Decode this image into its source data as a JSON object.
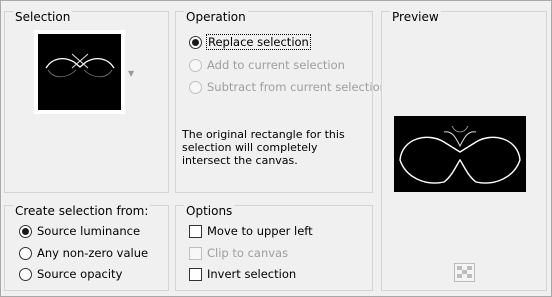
{
  "selection": {
    "title": "Selection"
  },
  "operation": {
    "title": "Operation",
    "options": [
      {
        "label": "Replace selection",
        "selected": true,
        "enabled": true
      },
      {
        "label": "Add to current selection",
        "selected": false,
        "enabled": false
      },
      {
        "label": "Subtract from current selection",
        "selected": false,
        "enabled": false
      }
    ],
    "description": "The original rectangle for this selection will completely intersect the canvas."
  },
  "preview": {
    "title": "Preview"
  },
  "create_from": {
    "title": "Create selection from:",
    "options": [
      {
        "label": "Source luminance",
        "selected": true
      },
      {
        "label": "Any non-zero value",
        "selected": false
      },
      {
        "label": "Source opacity",
        "selected": false
      }
    ]
  },
  "options": {
    "title": "Options",
    "checks": [
      {
        "label": "Move to upper left",
        "checked": false,
        "enabled": true
      },
      {
        "label": "Clip to canvas",
        "checked": false,
        "enabled": false
      },
      {
        "label": "Invert selection",
        "checked": false,
        "enabled": true
      }
    ]
  },
  "icons": {
    "dropdown": "chevron-down-icon",
    "preview_toggle": "checkerboard-icon"
  },
  "colors": {
    "background": "#f0f0f0",
    "canvas": "#000000",
    "shape": "#ffffff"
  }
}
